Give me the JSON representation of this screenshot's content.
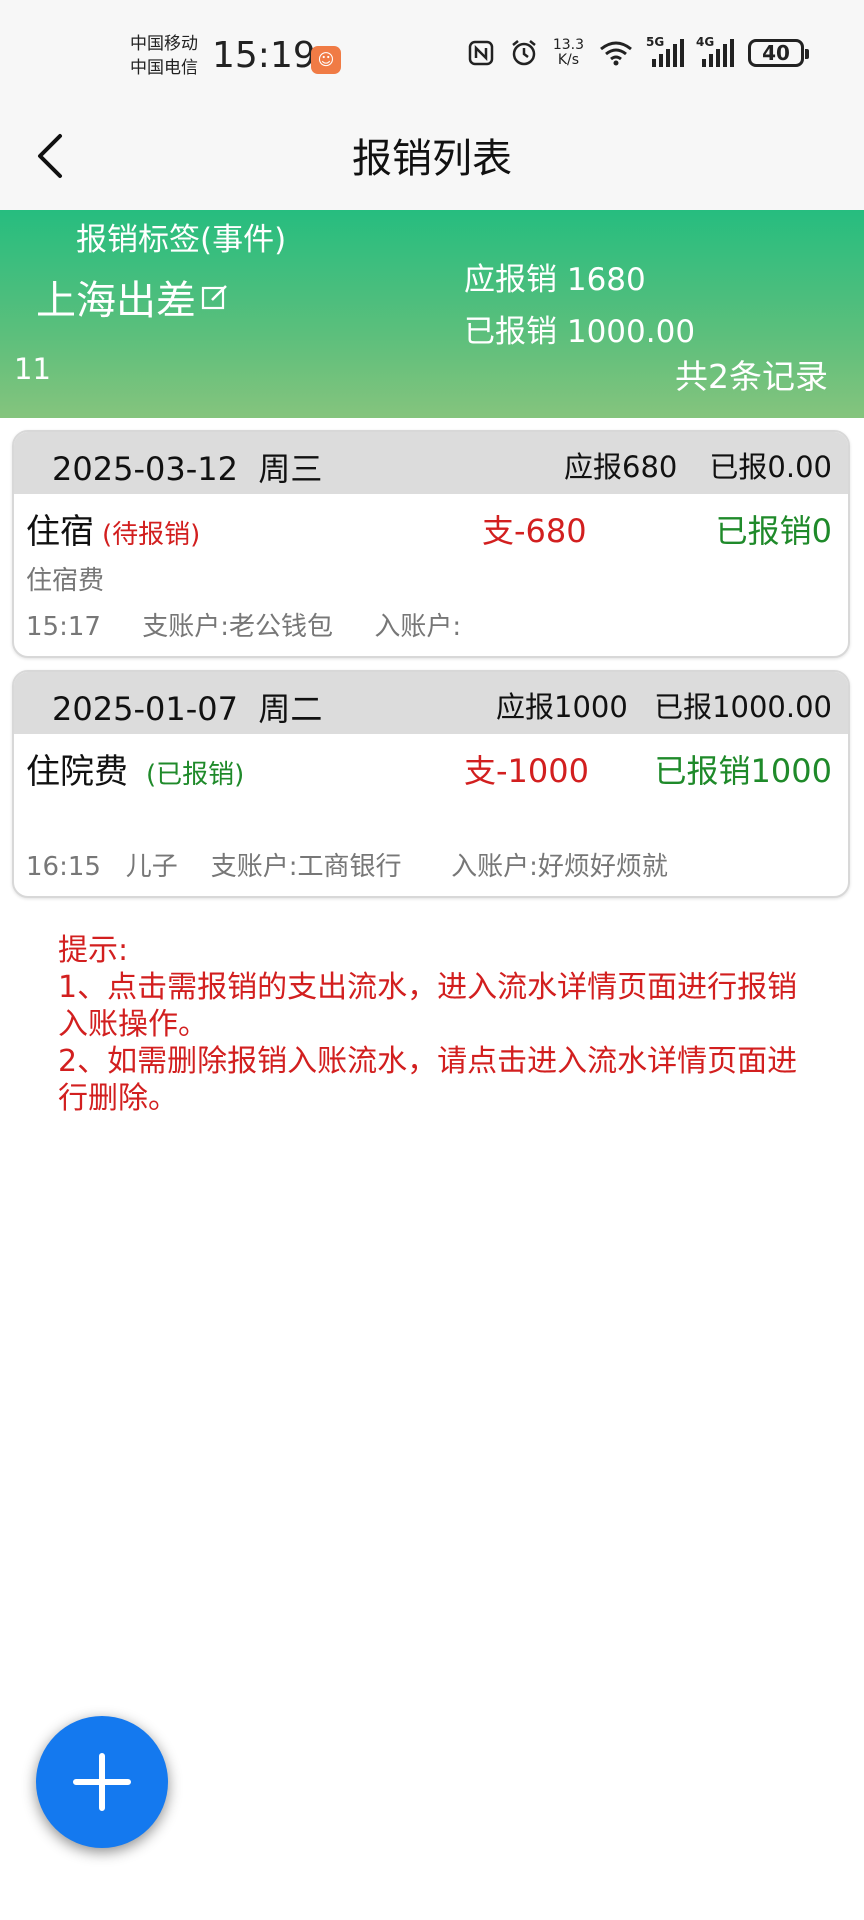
{
  "status_bar": {
    "carrier_1": "中国移动",
    "carrier_2": "中国电信",
    "time": "15:19",
    "net_speed_value": "13.3",
    "net_speed_unit": "K/s",
    "sim1_type": "5G",
    "sim2_type": "4G",
    "battery": "40",
    "icons": [
      "nfc-icon",
      "alarm-icon",
      "wifi-icon",
      "signal-5g-icon",
      "signal-4g-icon",
      "battery-icon"
    ]
  },
  "header": {
    "title": "报销列表",
    "back_icon": "back-chevron-icon"
  },
  "summary": {
    "tag_label": "报销标签(事件)",
    "tag_name": "上海出差",
    "due_label": "应报销",
    "due_value": "1680",
    "paid_label": "已报销",
    "paid_value": "1000.00",
    "left_count": "11",
    "record_count": "共2条记录",
    "gradient_top": "#26bd7f",
    "gradient_bottom": "#85c47d"
  },
  "records": [
    {
      "date": "2025-03-12",
      "weekday": "周三",
      "due": "应报680",
      "paid": "已报0.00",
      "category": "住宿",
      "status": "(待报销)",
      "status_color": "#d21f1f",
      "amount": "支-680",
      "reimbursed": "已报销0",
      "note": "住宿费",
      "meta": "15:17     支账户:老公钱包     入账户:"
    },
    {
      "date": "2025-01-07",
      "weekday": "周二",
      "due": "应报1000",
      "paid": "已报1000.00",
      "category": "住院费",
      "status": "(已报销)",
      "status_color": "#1f8a2a",
      "amount": "支-1000",
      "reimbursed": "已报销1000",
      "note": "",
      "meta": "16:15   儿子    支账户:工商银行      入账户:好烦好烦就"
    }
  ],
  "tips": {
    "title": "提示:",
    "line1": "1、点击需报销的支出流水，进入流水详情页面进行报销入账操作。",
    "line2": "2、如需删除报销入账流水，请点击进入流水详情页面进行删除。"
  },
  "fab": {
    "icon": "plus-icon",
    "color": "#1479ef"
  }
}
